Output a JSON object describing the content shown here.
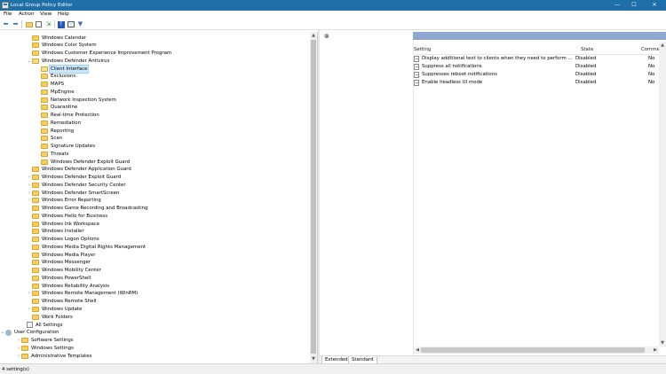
{
  "window": {
    "title": "Local Group Policy Editor",
    "minimize_glyph": "—",
    "maximize_glyph": "☐",
    "close_glyph": "✕"
  },
  "menu": [
    "File",
    "Action",
    "View",
    "Help"
  ],
  "toolbar": {
    "icons": [
      "back-arrow-icon",
      "forward-arrow-icon",
      "folder-up-icon",
      "show-hide-tree-icon",
      "export-list-icon",
      "help-icon",
      "properties-icon",
      "filter-icon"
    ]
  },
  "tree": [
    {
      "label": "Windows Calendar"
    },
    {
      "label": "Windows Color System"
    },
    {
      "label": "Windows Customer Experience Improvement Program"
    },
    {
      "label": "Windows Defender Antivirus"
    },
    {
      "label": "Client Interface"
    },
    {
      "label": "Exclusions"
    },
    {
      "label": "MAPS"
    },
    {
      "label": "MpEngine"
    },
    {
      "label": "Network Inspection System"
    },
    {
      "label": "Quarantine"
    },
    {
      "label": "Real-time Protection"
    },
    {
      "label": "Remediation"
    },
    {
      "label": "Reporting"
    },
    {
      "label": "Scan"
    },
    {
      "label": "Signature Updates"
    },
    {
      "label": "Threats"
    },
    {
      "label": "Windows Defender Exploit Guard"
    },
    {
      "label": "Windows Defender Application Guard"
    },
    {
      "label": "Windows Defender Exploit Guard"
    },
    {
      "label": "Windows Defender Security Center"
    },
    {
      "label": "Windows Defender SmartScreen"
    },
    {
      "label": "Windows Error Reporting"
    },
    {
      "label": "Windows Game Recording and Broadcasting"
    },
    {
      "label": "Windows Hello for Business"
    },
    {
      "label": "Windows Ink Workspace"
    },
    {
      "label": "Windows Installer"
    },
    {
      "label": "Windows Logon Options"
    },
    {
      "label": "Windows Media Digital Rights Management"
    },
    {
      "label": "Windows Media Player"
    },
    {
      "label": "Windows Messenger"
    },
    {
      "label": "Windows Mobility Center"
    },
    {
      "label": "Windows PowerShell"
    },
    {
      "label": "Windows Reliability Analysis"
    },
    {
      "label": "Windows Remote Management (WinRM)"
    },
    {
      "label": "Windows Remote Shell"
    },
    {
      "label": "Windows Update"
    },
    {
      "label": "Work Folders"
    },
    {
      "label": "All Settings"
    },
    {
      "label": "User Configuration"
    },
    {
      "label": "Software Settings"
    },
    {
      "label": "Windows Settings"
    },
    {
      "label": "Administrative Templates"
    }
  ],
  "list": {
    "headers": {
      "setting": "Setting",
      "state": "State",
      "comment": "Comment"
    },
    "rows": [
      {
        "setting": "Display additional text to clients when they need to perform ...",
        "state": "Disabled",
        "comment": "No"
      },
      {
        "setting": "Suppress all notifications",
        "state": "Disabled",
        "comment": "No"
      },
      {
        "setting": "Suppresses reboot notifications",
        "state": "Disabled",
        "comment": "No"
      },
      {
        "setting": "Enable headless UI mode",
        "state": "Disabled",
        "comment": "No"
      }
    ]
  },
  "tabs": [
    "Extended",
    "Standard"
  ],
  "status": {
    "text": "4 setting(s)"
  },
  "colors": {
    "titlebar": "#1f6fa8",
    "selection": "#cce8ff",
    "folder": "#f6cf62"
  }
}
